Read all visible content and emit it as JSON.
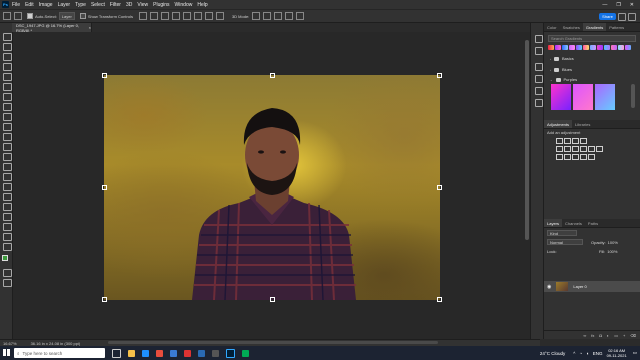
{
  "menubar": {
    "app_icon": "Ps",
    "items": [
      "File",
      "Edit",
      "Image",
      "Layer",
      "Type",
      "Select",
      "Filter",
      "3D",
      "View",
      "Plugins",
      "Window",
      "Help"
    ]
  },
  "options": {
    "auto_select_label": "Auto-Select:",
    "auto_select_value": "Layer",
    "transform_label": "Show Transform Controls",
    "mode_3d_label": "3D Mode:",
    "share_label": "Share"
  },
  "document": {
    "tab_title": "DSC_1947.JPG @ 16.7% (Layer 0, RGB/8) *",
    "zoom": "16.67%",
    "doc_info": "36.16 in x 24.08 in (300 ppi)"
  },
  "panels": {
    "top_tabs": [
      "Color",
      "Swatches",
      "Gradients",
      "Patterns"
    ],
    "active_top_tab": "Gradients",
    "gradient_search_placeholder": "Search Gradients",
    "gradient_folders": [
      "Basics",
      "Blues",
      "Purples"
    ],
    "adjust_tabs": [
      "Adjustments",
      "Libraries"
    ],
    "add_adjustment_label": "Add an adjustment",
    "layers_tabs": [
      "Layers",
      "Channels",
      "Paths"
    ],
    "kind_label": "Kind",
    "blend_mode": "Normal",
    "opacity_label": "Opacity:",
    "opacity_value": "100%",
    "lock_label": "Lock:",
    "fill_label": "Fill:",
    "fill_value": "100%",
    "layer_name": "Layer 0"
  },
  "taskbar": {
    "search_placeholder": "Type here to search",
    "weather": "24°C  Cloudy",
    "language": "ENG",
    "time": "02:16 AM",
    "date": "09-11-2021"
  },
  "colors": {
    "accent": "#1473e6",
    "panel_bg": "#323232",
    "workspace_bg": "#282828"
  }
}
